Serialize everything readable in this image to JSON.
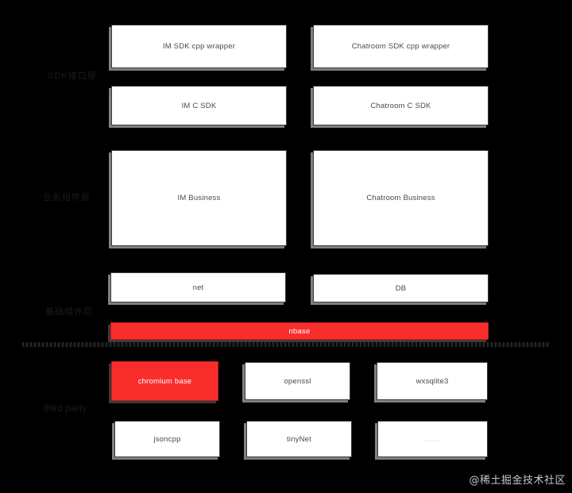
{
  "diagram": {
    "background_color": "#000000",
    "box_fill": "#ffffff",
    "highlight_color": "#fa2d2d",
    "shadow_color": "#808080",
    "text_color": "#4a4a4a"
  },
  "layer_labels": [
    {
      "id": "sdk-layer",
      "text": "SDK接口层"
    },
    {
      "id": "business-layer",
      "text": "业务组件层"
    },
    {
      "id": "base-layer",
      "text": "基础组件层"
    },
    {
      "id": "third-party",
      "text": "third party"
    }
  ],
  "boxes": [
    {
      "id": "im-sdk-cpp-wrapper",
      "label": "IM SDK cpp wrapper",
      "style": "white"
    },
    {
      "id": "chatroom-sdk-cpp-wrapper",
      "label": "Chatroom SDK cpp wrapper",
      "style": "white"
    },
    {
      "id": "im-c-sdk",
      "label": "IM C SDK",
      "style": "white"
    },
    {
      "id": "chatroom-c-sdk",
      "label": "Chatroom C SDK",
      "style": "white"
    },
    {
      "id": "im-business",
      "label": "IM Business",
      "style": "white"
    },
    {
      "id": "chatroom-business",
      "label": "Chatroom Business",
      "style": "white"
    },
    {
      "id": "net",
      "label": "net",
      "style": "white"
    },
    {
      "id": "db",
      "label": "DB",
      "style": "white"
    },
    {
      "id": "nbase",
      "label": "nbase",
      "style": "red"
    },
    {
      "id": "chromium-base",
      "label": "chromium base",
      "style": "red"
    },
    {
      "id": "openssl",
      "label": "openssl",
      "style": "white"
    },
    {
      "id": "wxsqlite3",
      "label": "wxsqlite3",
      "style": "white"
    },
    {
      "id": "jsoncpp",
      "label": "jsoncpp",
      "style": "white"
    },
    {
      "id": "tinynet",
      "label": "tinyNet",
      "style": "white"
    },
    {
      "id": "more",
      "label": "......",
      "style": "white"
    }
  ],
  "watermark": {
    "text": "@稀土掘金技术社区"
  }
}
